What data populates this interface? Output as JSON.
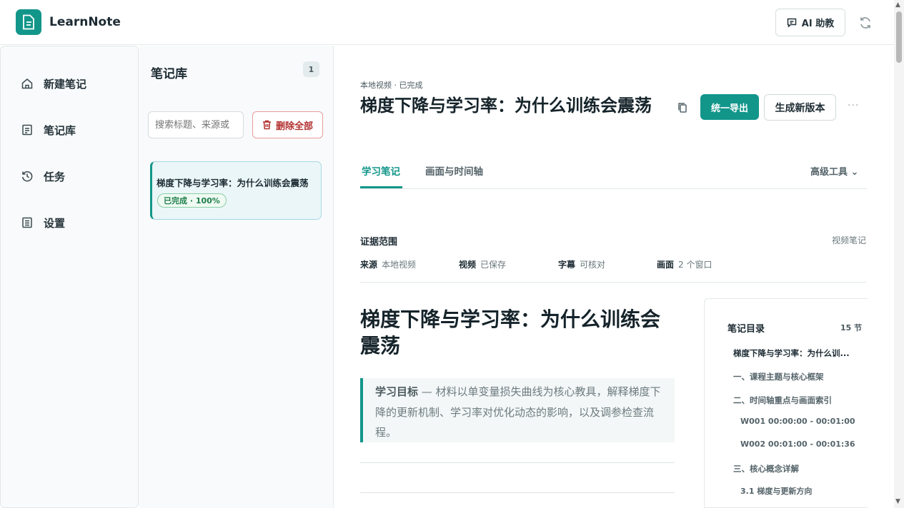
{
  "app": {
    "title": "LearnNote",
    "accent": "#12968a"
  },
  "header": {
    "ai_label": "AI 助教"
  },
  "nav": {
    "items": [
      {
        "label": "新建笔记",
        "icon": "home-icon"
      },
      {
        "label": "笔记库",
        "icon": "notebook-icon"
      },
      {
        "label": "任务",
        "icon": "history-icon"
      },
      {
        "label": "设置",
        "icon": "document-icon"
      }
    ]
  },
  "library": {
    "title": "笔记库",
    "count": "1",
    "search_placeholder": "搜索标题、来源或",
    "delete_all_label": "删除全部",
    "cards": [
      {
        "title": "梯度下降与学习率：为什么训练会震荡",
        "badge": "已完成 · 100%"
      }
    ]
  },
  "note": {
    "meta": "本地视频 · 已完成",
    "title": "梯度下降与学习率：为什么训练会震荡",
    "export_label": "统一导出",
    "new_version_label": "生成新版本",
    "more_label": "···",
    "tabs": [
      {
        "label": "学习笔记",
        "active": true
      },
      {
        "label": "画面与时间轴",
        "active": false
      }
    ],
    "advanced_tools_label": "高级工具",
    "advanced_tools_caret": "⌄",
    "evidence": {
      "title": "证据范围",
      "right_label": "视频笔记",
      "items": [
        {
          "key": "来源",
          "value": "本地视频"
        },
        {
          "key": "视频",
          "value": "已保存"
        },
        {
          "key": "字幕",
          "value": "可核对"
        },
        {
          "key": "画面",
          "value": "2 个窗口"
        }
      ]
    },
    "doc_title": "梯度下降与学习率：为什么训练会震荡",
    "goal_label": "学习目标",
    "goal_text": " — 材料以单变量损失曲线为核心教具，解释梯度下降的更新机制、学习率对优化动态的影响，以及调参检查流程。"
  },
  "toc": {
    "title": "笔记目录",
    "count": "15 节",
    "items": [
      {
        "label": "梯度下降与学习率：为什么训...",
        "level": 1
      },
      {
        "label": "一、课程主题与核心框架",
        "level": 1
      },
      {
        "label": "二、时间轴重点与画面索引",
        "level": 1
      },
      {
        "label": "W001 00:00:00 - 00:01:00",
        "level": 2
      },
      {
        "label": "W002 00:01:00 - 00:01:36",
        "level": 2
      },
      {
        "label": "三、核心概念详解",
        "level": 1
      },
      {
        "label": "3.1 梯度与更新方向",
        "level": 2
      }
    ]
  }
}
